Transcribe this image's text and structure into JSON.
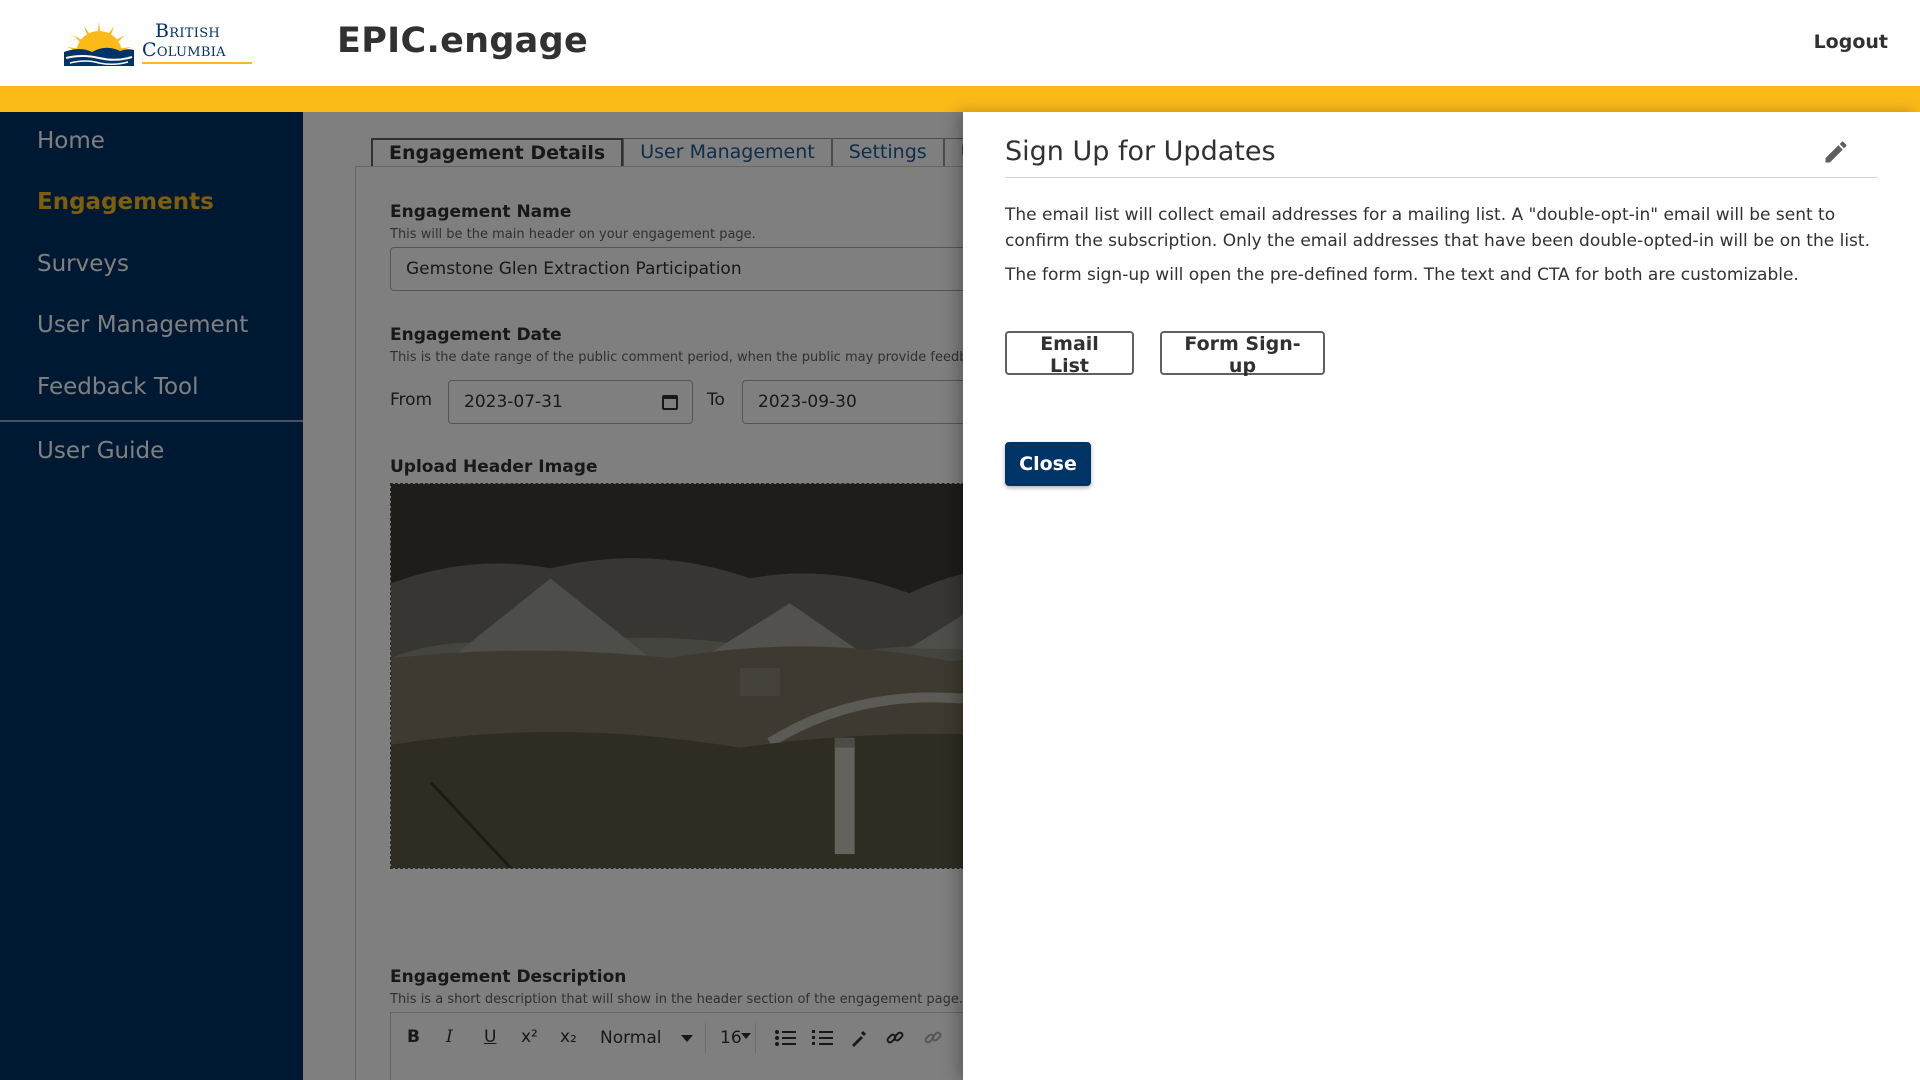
{
  "header": {
    "logo_line1": "British",
    "logo_line2": "Columbia",
    "app_title": "EPIC.engage",
    "logout_label": "Logout"
  },
  "sidebar": {
    "items": [
      {
        "label": "Home",
        "active": false
      },
      {
        "label": "Engagements",
        "active": true
      },
      {
        "label": "Surveys",
        "active": false
      },
      {
        "label": "User Management",
        "active": false
      },
      {
        "label": "Feedback Tool",
        "active": false
      },
      {
        "label": "User Guide",
        "active": false
      }
    ]
  },
  "main": {
    "tabs": [
      {
        "label": "Engagement Details",
        "active": true
      },
      {
        "label": "User Management",
        "active": false
      },
      {
        "label": "Settings",
        "active": false
      },
      {
        "label": "UR",
        "active": false
      }
    ],
    "engagement_name": {
      "label": "Engagement Name",
      "hint": "This will be the main header on your engagement page.",
      "value": "Gemstone Glen Extraction Participation"
    },
    "engagement_date": {
      "label": "Engagement Date",
      "hint": "This is the date range of the public comment period, when the public may provide feedb",
      "from_label": "From",
      "from_value": "2023-07-31",
      "to_label": "To",
      "to_value": "2023-09-30"
    },
    "upload_header_image": {
      "label": "Upload Header Image"
    },
    "engagement_description": {
      "label": "Engagement Description",
      "hint": "This is a short description that will show in the header section of the engagement page.",
      "toolbar": {
        "bold": "B",
        "italic": "I",
        "underline": "U",
        "superscript": "x²",
        "subscript": "x₂",
        "block_type": "Normal",
        "font_size": "16"
      }
    }
  },
  "drawer": {
    "title": "Sign Up for Updates",
    "paragraph1": "The email list will collect email addresses for a mailing list. A \"double-opt-in\" email will be sent to confirm the subscription. Only the email addresses that have been double-opted-in will be on the list.",
    "paragraph2": "The form sign-up will open the pre-defined form. The text and CTA for both are customizable.",
    "email_list_label": "Email List",
    "form_signup_label": "Form Sign-up",
    "close_label": "Close"
  },
  "colors": {
    "navy": "#003366",
    "gold": "#fcba19",
    "text": "#313132"
  }
}
